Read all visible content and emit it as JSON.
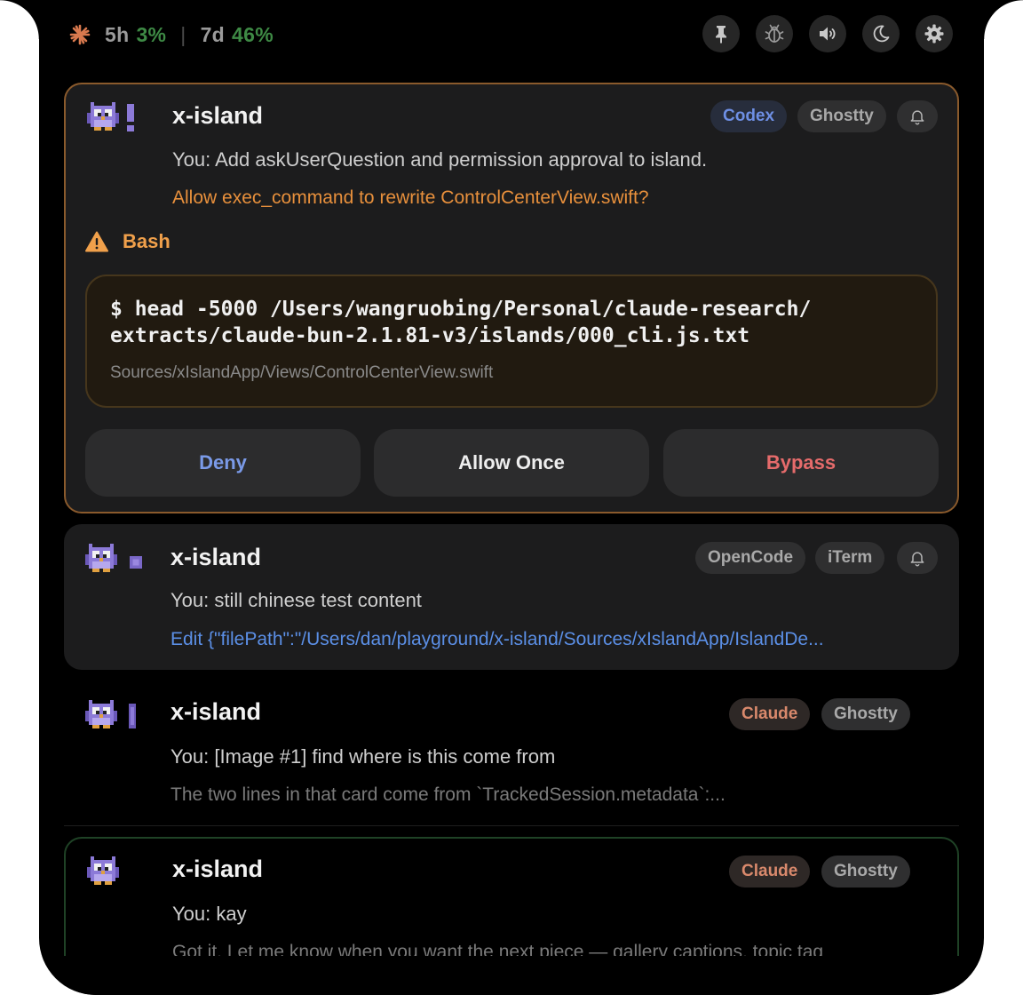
{
  "usage": {
    "session_label": "5h",
    "session_value": "3%",
    "separator": "|",
    "weekly_label": "7d",
    "weekly_value": "46%"
  },
  "toolbar": {
    "icons": [
      "pin-icon",
      "bug-icon",
      "speaker-icon",
      "moon-icon",
      "gear-icon"
    ]
  },
  "sessions": [
    {
      "title": "x-island",
      "prompt": "You: Add askUserQuestion and permission approval to island.",
      "status_text": "Allow exec_command to rewrite ControlCenterView.swift?",
      "agent": "Codex",
      "terminal": "Ghostty",
      "permission": {
        "tool": "Bash",
        "command": "$ head -5000 /Users/wangruobing/Personal/claude-research/\nextracts/claude-bun-2.1.81-v3/islands/000_cli.js.txt",
        "file": "Sources/xIslandApp/Views/ControlCenterView.swift",
        "deny_label": "Deny",
        "allow_label": "Allow Once",
        "bypass_label": "Bypass"
      }
    },
    {
      "title": "x-island",
      "prompt": "You: still chinese test content",
      "status_text": "Edit {\"filePath\":\"/Users/dan/playground/x-island/Sources/xIslandApp/IslandDe...",
      "agent": "OpenCode",
      "terminal": "iTerm"
    },
    {
      "title": "x-island",
      "prompt": "You: [Image #1] find where is this come from",
      "status_text": "The two lines in that card come from `TrackedSession.metadata`:...",
      "agent": "Claude",
      "terminal": "Ghostty"
    },
    {
      "title": "x-island",
      "prompt": "You: kay",
      "status_text": "Got it. Let me know when you want the next piece — gallery captions, topic tag",
      "agent": "Claude",
      "terminal": "Ghostty"
    }
  ],
  "colors": {
    "usage_ok": "#3e8a45",
    "approval_border": "#8a5a2c",
    "approval_text": "#e8903c",
    "edit_text": "#5b8fe6",
    "done_border": "#1f4226",
    "deny": "#7a9ae8",
    "bypass": "#e66b6b"
  }
}
